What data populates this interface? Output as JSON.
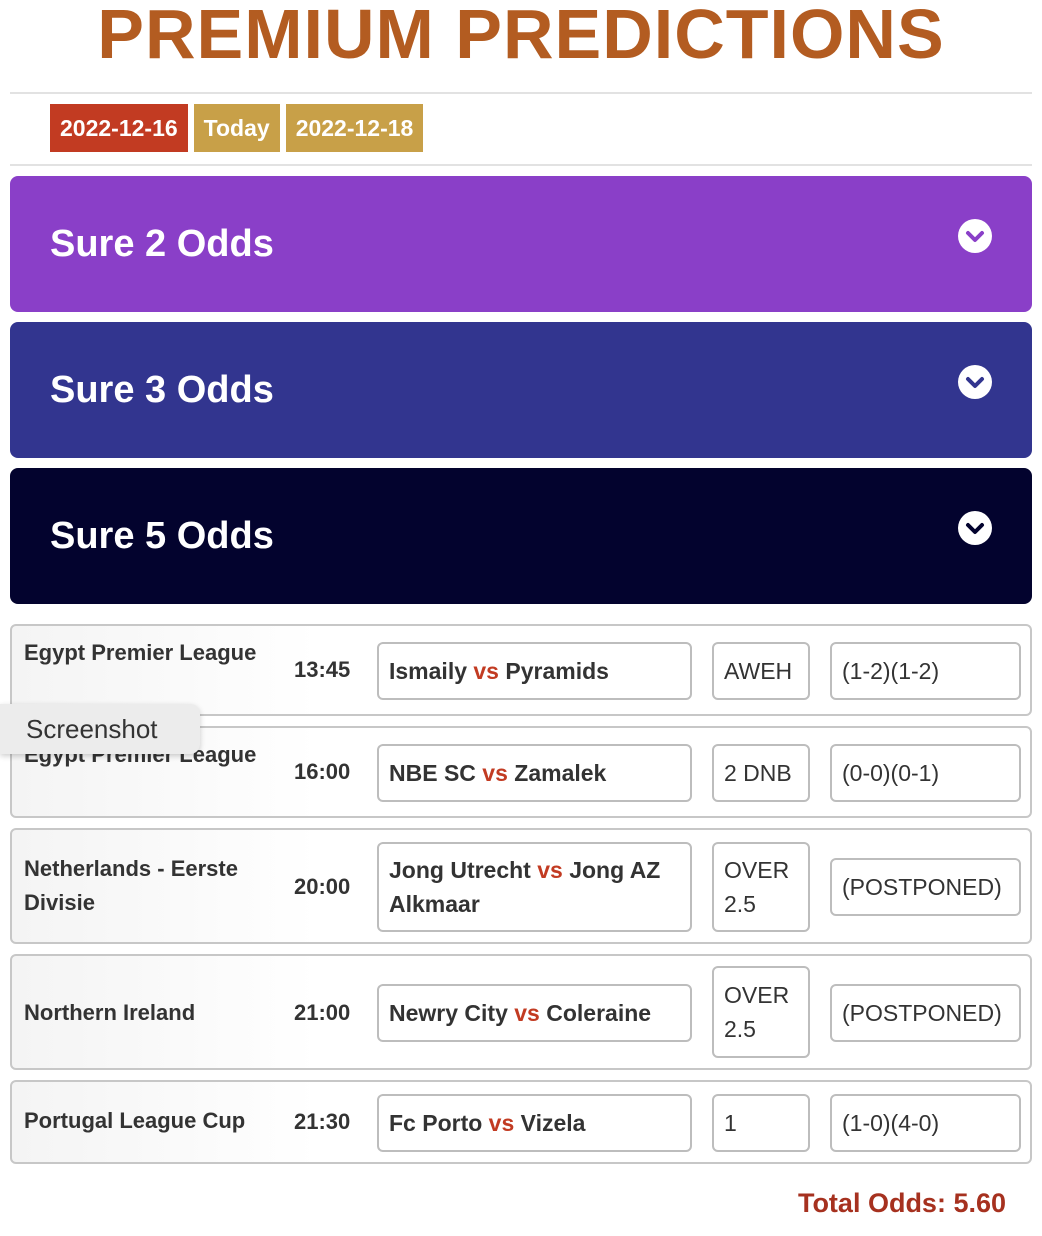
{
  "header": {
    "title": "PREMIUM PREDICTIONS"
  },
  "dates": {
    "prev": "2022-12-16",
    "current": "Today",
    "next": "2022-12-18"
  },
  "sections": [
    {
      "label": "Sure 2 Odds",
      "color": "#8a3fc8"
    },
    {
      "label": "Sure 3 Odds",
      "color": "#32358f"
    },
    {
      "label": "Sure 5 Odds",
      "color": "#03032e"
    }
  ],
  "matches": [
    {
      "league": "Egypt Premier League",
      "time": "13:45",
      "home": "Ismaily",
      "vs": "vs",
      "away": "Pyramids",
      "tip": "AWEH",
      "score": "(1-2)(1-2)"
    },
    {
      "league": "Egypt Premier League",
      "time": "16:00",
      "home": "NBE SC",
      "vs": "vs",
      "away": "Zamalek",
      "tip": "2 DNB",
      "score": "(0-0)(0-1)"
    },
    {
      "league": "Netherlands - Eerste Divisie",
      "time": "20:00",
      "home": "Jong Utrecht",
      "vs": "vs",
      "away": "Jong AZ Alkmaar",
      "tip": "OVER 2.5",
      "score": "(POSTPONED)"
    },
    {
      "league": "Northern Ireland",
      "time": "21:00",
      "home": "Newry City",
      "vs": "vs",
      "away": "Coleraine",
      "tip": "OVER 2.5",
      "score": "(POSTPONED)"
    },
    {
      "league": "Portugal League Cup",
      "time": "21:30",
      "home": "Fc Porto",
      "vs": "vs",
      "away": "Vizela",
      "tip": "1",
      "score": "(1-0)(4-0)"
    }
  ],
  "tooltip": "Screenshot",
  "footer": {
    "total": "Total Odds: 5.60"
  },
  "icons": {
    "chevron": "chevron-down-circle-icon"
  }
}
